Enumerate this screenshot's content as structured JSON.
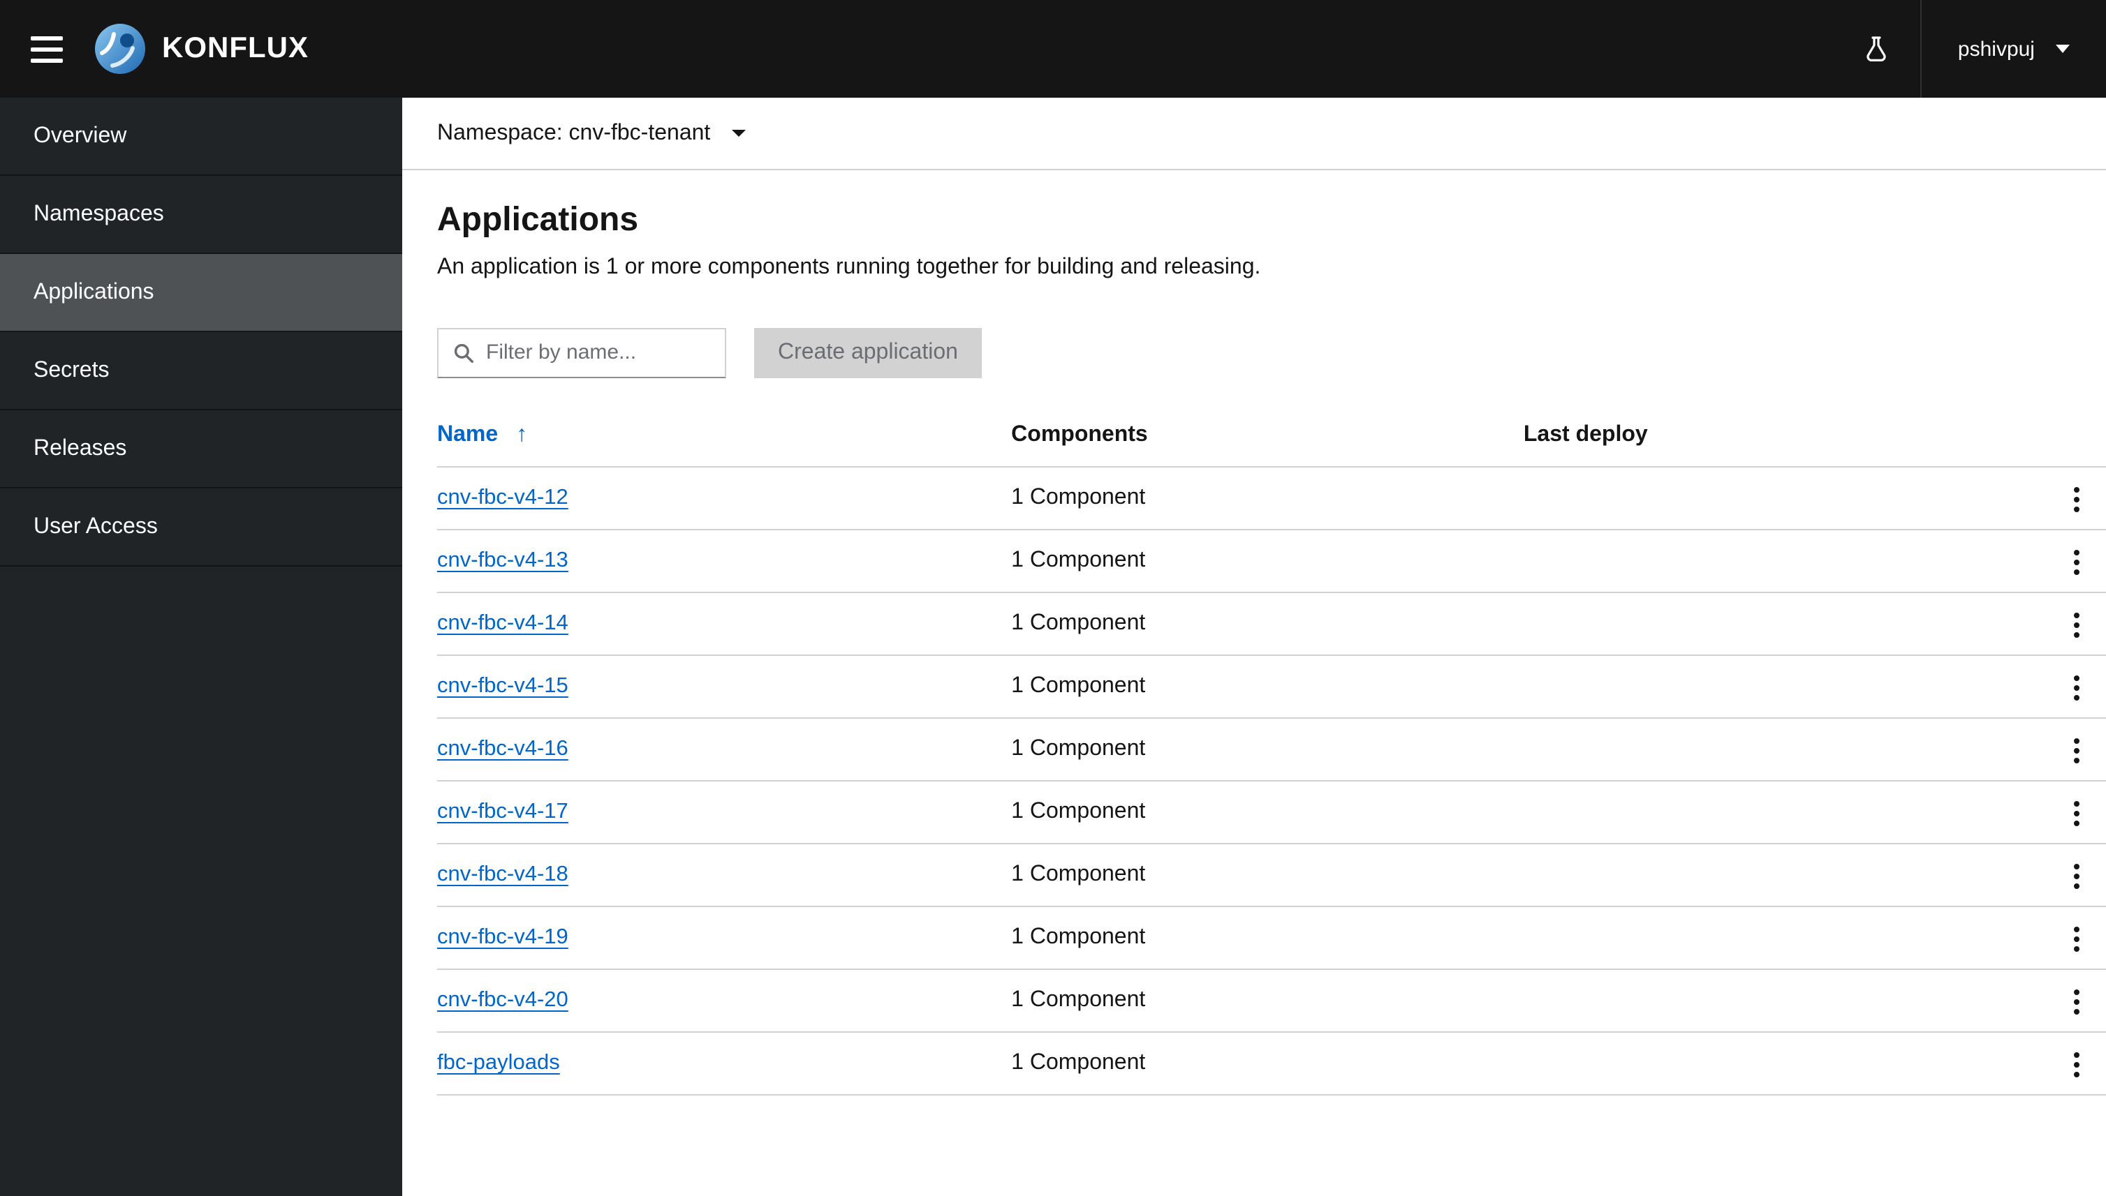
{
  "masthead": {
    "brand": "KONFLUX",
    "user": {
      "name": "pshivpuj"
    }
  },
  "sidebar": {
    "items": [
      {
        "id": "overview",
        "label": "Overview",
        "active": false
      },
      {
        "id": "namespaces",
        "label": "Namespaces",
        "active": false
      },
      {
        "id": "applications",
        "label": "Applications",
        "active": true
      },
      {
        "id": "secrets",
        "label": "Secrets",
        "active": false
      },
      {
        "id": "releases",
        "label": "Releases",
        "active": false
      },
      {
        "id": "user-access",
        "label": "User Access",
        "active": false
      }
    ]
  },
  "namespace_bar": {
    "label": "Namespace: cnv-fbc-tenant"
  },
  "page": {
    "title": "Applications",
    "description": "An application is 1 or more components running together for building and releasing."
  },
  "toolbar": {
    "filter_placeholder": "Filter by name...",
    "create_button_label": "Create application",
    "create_button_disabled": true
  },
  "table": {
    "headers": [
      "Name",
      "Components",
      "Last deploy"
    ],
    "sort_icon": "↑",
    "rows": [
      {
        "name": "cnv-fbc-v4-12",
        "components": "1 Component",
        "last_deploy": ""
      },
      {
        "name": "cnv-fbc-v4-13",
        "components": "1 Component",
        "last_deploy": ""
      },
      {
        "name": "cnv-fbc-v4-14",
        "components": "1 Component",
        "last_deploy": ""
      },
      {
        "name": "cnv-fbc-v4-15",
        "components": "1 Component",
        "last_deploy": ""
      },
      {
        "name": "cnv-fbc-v4-16",
        "components": "1 Component",
        "last_deploy": ""
      },
      {
        "name": "cnv-fbc-v4-17",
        "components": "1 Component",
        "last_deploy": ""
      },
      {
        "name": "cnv-fbc-v4-18",
        "components": "1 Component",
        "last_deploy": ""
      },
      {
        "name": "cnv-fbc-v4-19",
        "components": "1 Component",
        "last_deploy": ""
      },
      {
        "name": "cnv-fbc-v4-20",
        "components": "1 Component",
        "last_deploy": ""
      },
      {
        "name": "fbc-payloads",
        "components": "1 Component",
        "last_deploy": ""
      }
    ]
  },
  "colors": {
    "masthead_bg": "#151515",
    "sidebar_bg": "#212427",
    "sidebar_active_bg": "#4f5255",
    "link_blue": "#0066cc",
    "muted_text": "#6a6e73",
    "table_border": "#d2d2d2",
    "disabled_button_bg": "#d2d2d2"
  }
}
